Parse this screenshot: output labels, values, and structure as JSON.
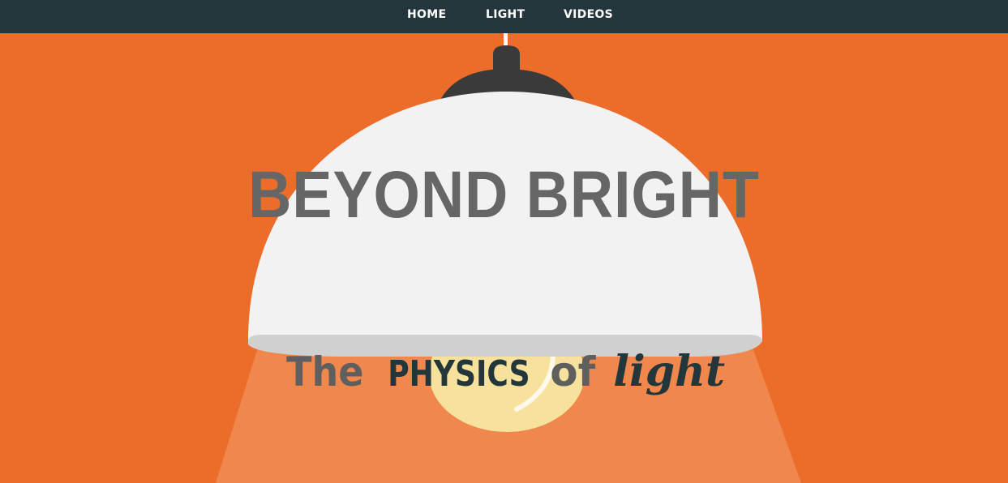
{
  "nav": {
    "items": [
      {
        "label": "HOME"
      },
      {
        "label": "LIGHT"
      },
      {
        "label": "VIDEOS"
      }
    ]
  },
  "hero": {
    "headline": "BEYOND BRIGHT",
    "subtitle": {
      "part1": "The",
      "part2": "PHYSICS",
      "part3": "of",
      "part4": "light"
    }
  },
  "colors": {
    "background": "#ec6d29",
    "nav_bg": "#22363c",
    "lamp_shade": "#f2f2f2",
    "lamp_cap": "#3a3a3a",
    "bulb": "#f7e29d",
    "light_beam": "#f0884d",
    "headline": "#666666",
    "subtitle_dark": "#22363c",
    "subtitle_gray": "#5f5f5f"
  }
}
